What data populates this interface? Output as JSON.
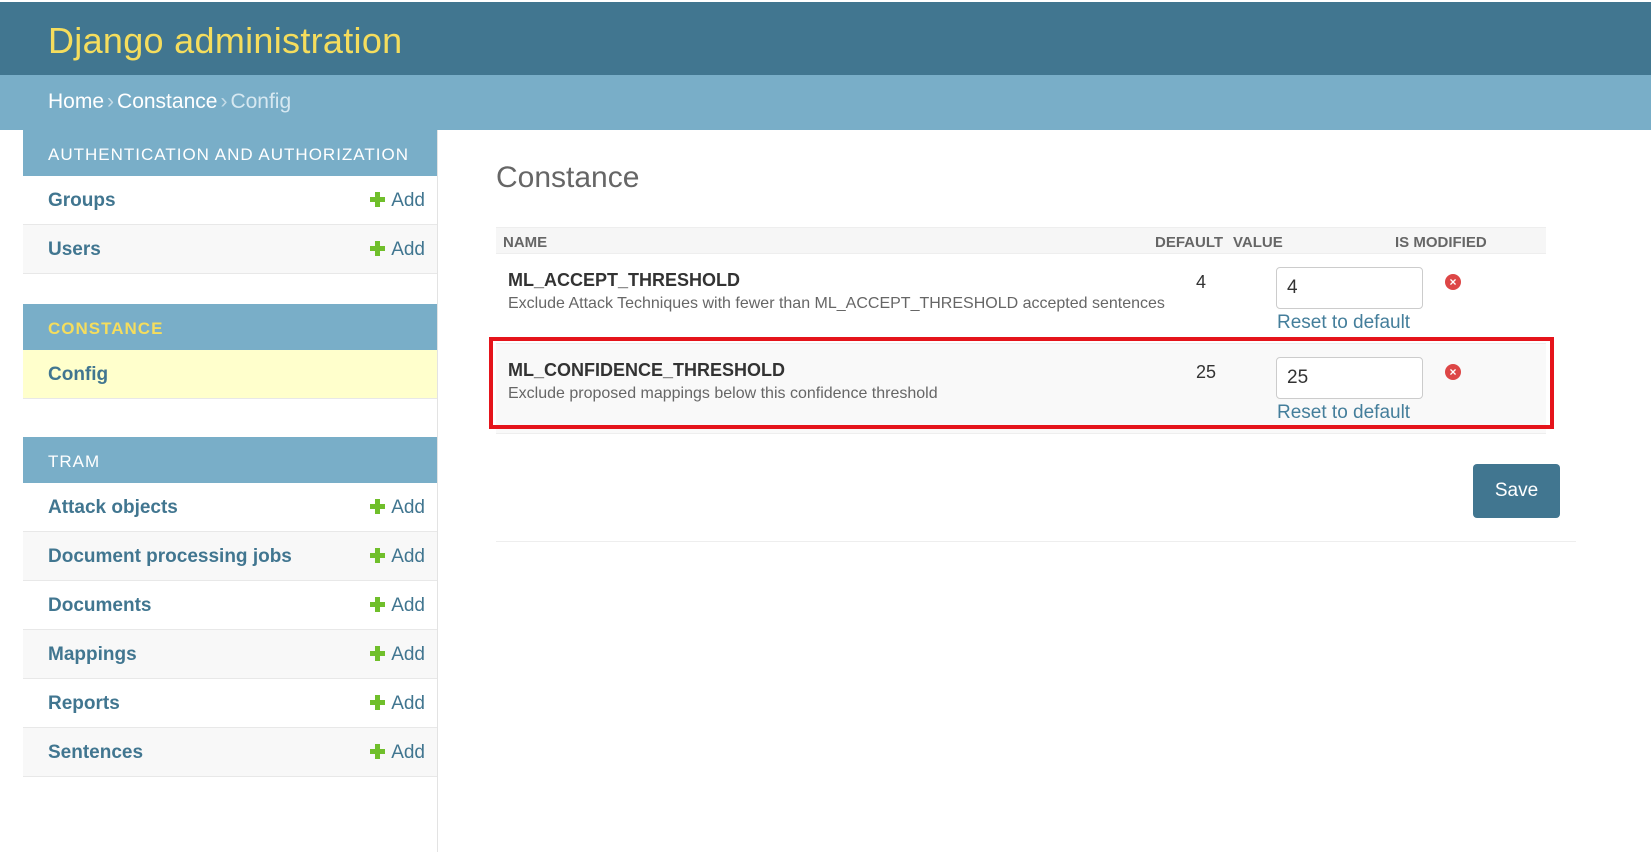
{
  "header": {
    "site_name": "Django administration"
  },
  "breadcrumbs": {
    "home": "Home",
    "app": "Constance",
    "current": "Config",
    "separator": "›"
  },
  "sidebar": {
    "modules": [
      {
        "caption": "AUTHENTICATION AND AUTHORIZATION",
        "items": [
          {
            "label": "Groups",
            "add": "Add"
          },
          {
            "label": "Users",
            "add": "Add"
          }
        ]
      },
      {
        "caption": "CONSTANCE",
        "items": [
          {
            "label": "Config"
          }
        ]
      },
      {
        "caption": "TRAM",
        "items": [
          {
            "label": "Attack objects",
            "add": "Add"
          },
          {
            "label": "Document processing jobs",
            "add": "Add"
          },
          {
            "label": "Documents",
            "add": "Add"
          },
          {
            "label": "Mappings",
            "add": "Add"
          },
          {
            "label": "Reports",
            "add": "Add"
          },
          {
            "label": "Sentences",
            "add": "Add"
          }
        ]
      }
    ]
  },
  "main": {
    "title": "Constance",
    "columns": {
      "name": "NAME",
      "default": "DEFAULT",
      "value": "VALUE",
      "is_modified": "IS MODIFIED"
    },
    "rows": [
      {
        "name": "ML_ACCEPT_THRESHOLD",
        "description": "Exclude Attack Techniques with fewer than ML_ACCEPT_THRESHOLD accepted sentences",
        "default": "4",
        "value": "4",
        "reset": "Reset to default",
        "modified_icon": "x-circle-icon"
      },
      {
        "name": "ML_CONFIDENCE_THRESHOLD",
        "description": "Exclude proposed mappings below this confidence threshold",
        "default": "25",
        "value": "25",
        "reset": "Reset to default",
        "modified_icon": "x-circle-icon"
      }
    ],
    "save_label": "Save"
  },
  "colors": {
    "header_bg": "#417690",
    "site_name": "#f5dd5d",
    "breadcrumbs_bg": "#79aec8",
    "link": "#417690",
    "add_icon": "#70bf2b",
    "selected_row": "#ffffcc",
    "highlight_box": "#e5141b",
    "modified_icon": "#dd4646"
  }
}
